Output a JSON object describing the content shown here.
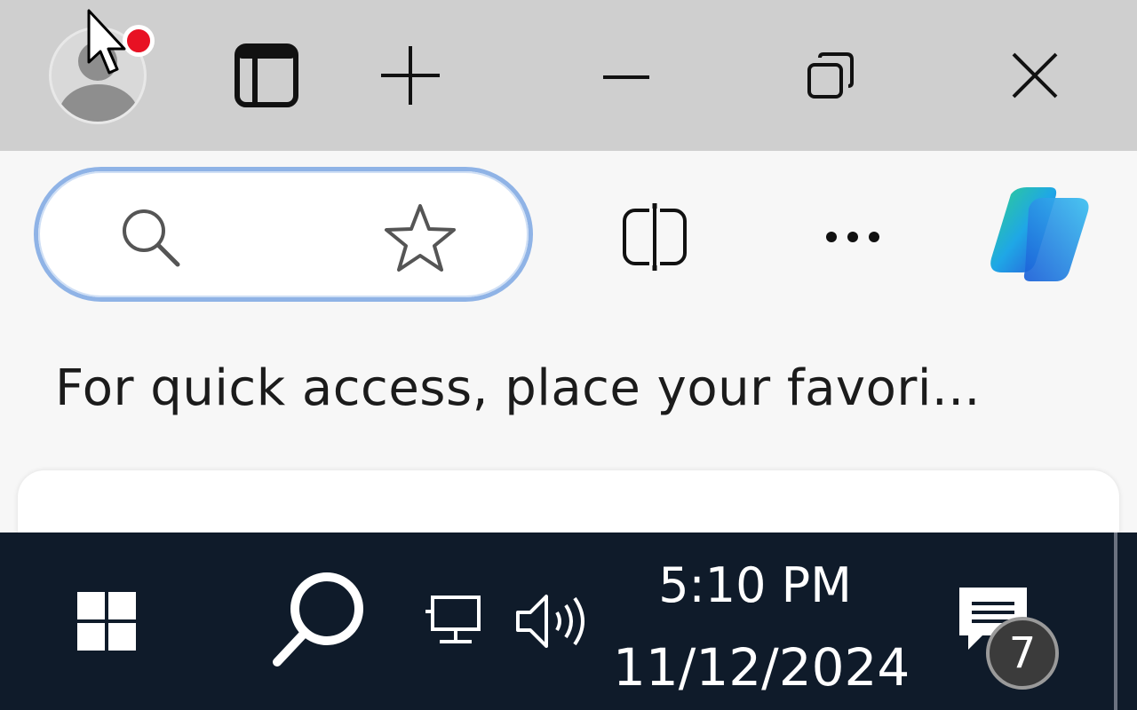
{
  "titlebar": {
    "profile": {
      "icon": "profile-avatar-icon",
      "notification_color": "#e81123"
    },
    "buttons": [
      {
        "name": "tab-actions-icon"
      },
      {
        "name": "new-tab-icon"
      },
      {
        "name": "minimize-icon"
      },
      {
        "name": "restore-icon"
      },
      {
        "name": "close-icon"
      }
    ]
  },
  "toolbar": {
    "address_bar": {
      "icons": [
        "search-icon",
        "favorite-star-icon"
      ],
      "border_color": "#8fb3e6"
    },
    "split_screen_icon": "split-screen-icon",
    "more_icon": "more-icon",
    "copilot_icon": "copilot-icon"
  },
  "favorites_bar": {
    "message": "For quick access, place your favori..."
  },
  "taskbar": {
    "start_icon": "windows-start-icon",
    "search_icon": "taskbar-search-icon",
    "network_icon": "network-icon",
    "volume_icon": "volume-icon",
    "time": "5:10 PM",
    "date": "11/12/2024",
    "notifications": {
      "icon": "notification-center-icon",
      "count": "7"
    },
    "background": "#0f1b2a"
  }
}
